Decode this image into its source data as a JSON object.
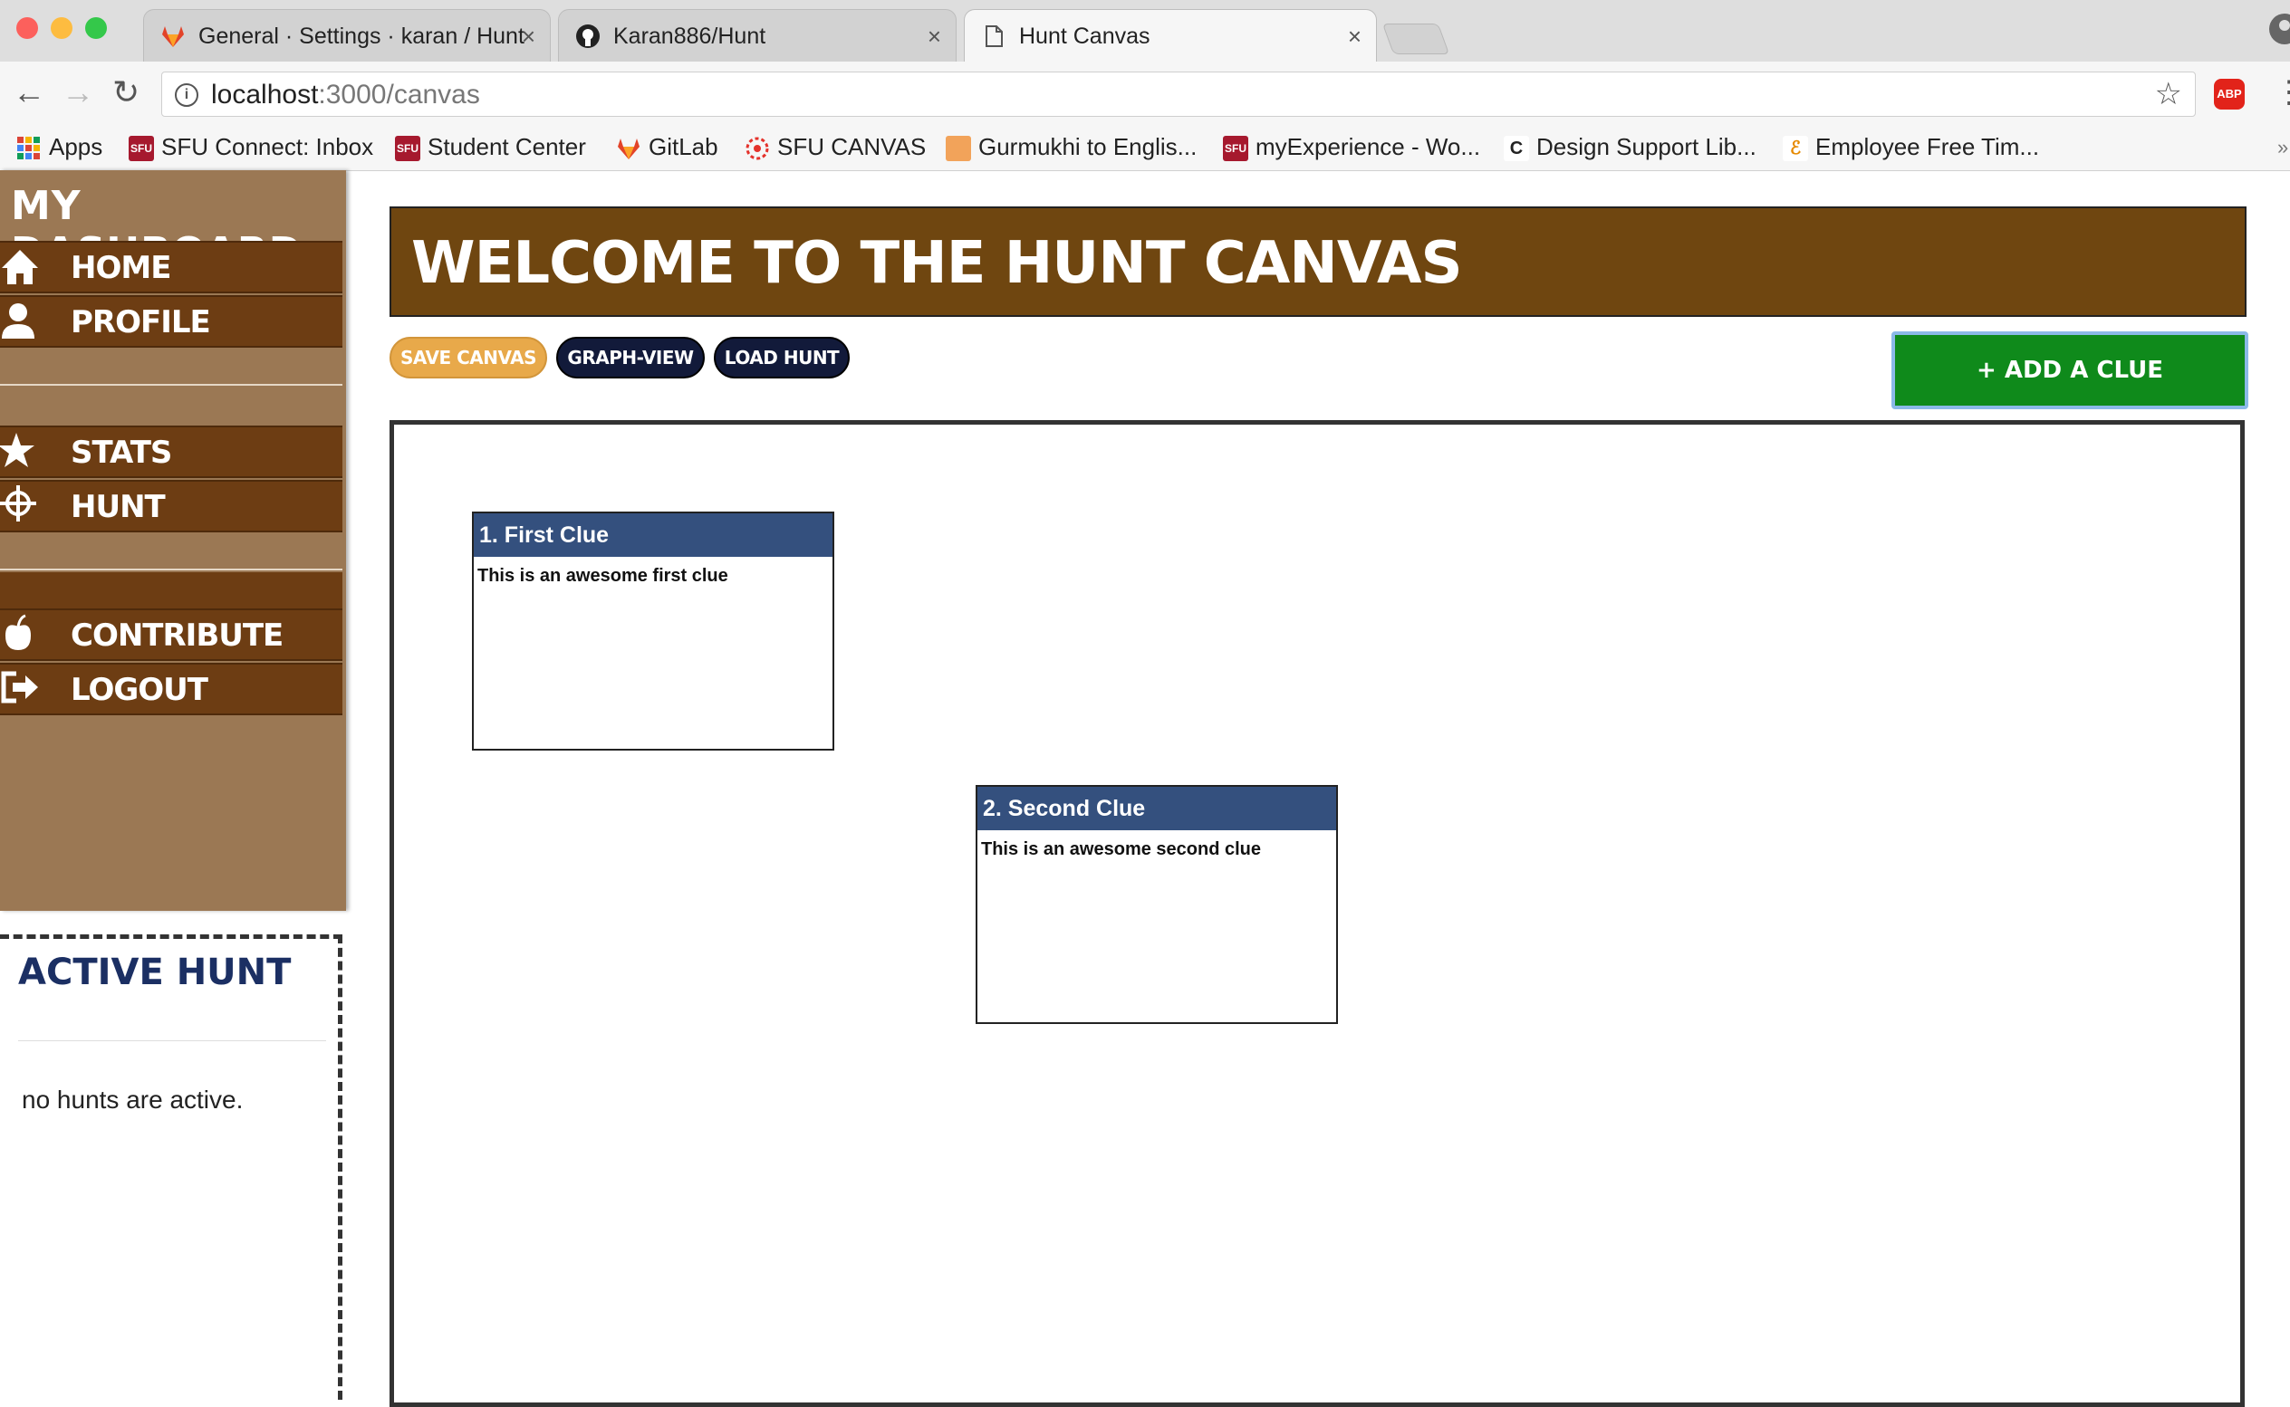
{
  "browser": {
    "tabs": [
      {
        "title": "General · Settings · karan / Hunt",
        "icon": "gitlab-icon",
        "active": false
      },
      {
        "title": "Karan886/Hunt",
        "icon": "github-icon",
        "active": false
      },
      {
        "title": "Hunt Canvas",
        "icon": "page-icon",
        "active": true
      }
    ],
    "url_host": "localhost",
    "url_path": ":3000/canvas",
    "bookmarks": [
      {
        "label": "Apps",
        "icon": "apps-grid-icon"
      },
      {
        "label": "SFU Connect: Inbox",
        "icon": "sfu-icon"
      },
      {
        "label": "Student Center",
        "icon": "sfu-icon"
      },
      {
        "label": "GitLab",
        "icon": "gitlab-icon"
      },
      {
        "label": "SFU CANVAS",
        "icon": "canvas-icon"
      },
      {
        "label": "Gurmukhi to Englis...",
        "icon": "gurmukhi-icon"
      },
      {
        "label": "myExperience - Wo...",
        "icon": "sfu-icon"
      },
      {
        "label": "Design Support Lib...",
        "icon": "design-support-icon"
      },
      {
        "label": "Employee Free Tim...",
        "icon": "employee-icon"
      }
    ],
    "abp_label": "ABP",
    "colors": {
      "sfu_red": "#a6192e",
      "gitlab_orange": "#e24329"
    }
  },
  "sidebar": {
    "title": "MY DASHBOARD",
    "items": [
      {
        "label": "HOME",
        "icon": "home-icon"
      },
      {
        "label": "PROFILE",
        "icon": "user-icon"
      },
      {
        "label": "STATS",
        "icon": "star-icon"
      },
      {
        "label": "HUNT",
        "icon": "crosshair-icon"
      },
      {
        "label": "CONTRIBUTE",
        "icon": "apple-icon"
      },
      {
        "label": "LOGOUT",
        "icon": "logout-icon"
      }
    ],
    "colors": {
      "panel": "#9b7854",
      "item": "#6d3d13"
    }
  },
  "active_hunt": {
    "title": "ACTIVE HUNT",
    "message": "no hunts are active."
  },
  "main": {
    "welcome": "WELCOME TO THE HUNT CANVAS",
    "buttons": {
      "save": "SAVE CANVAS",
      "graph": "GRAPH-VIEW",
      "load": "LOAD HUNT",
      "add_clue": "+ ADD A CLUE"
    },
    "clues": [
      {
        "title": "1. First Clue",
        "body": "This is an awesome first clue"
      },
      {
        "title": "2. Second Clue",
        "body": "This is an awesome second clue"
      }
    ],
    "colors": {
      "welcome_bg": "#6f4610",
      "clue_header": "#34507e",
      "add_clue": "#0f8a1b",
      "save_pill": "#e8a94a",
      "dark_pill": "#121a3a"
    }
  }
}
